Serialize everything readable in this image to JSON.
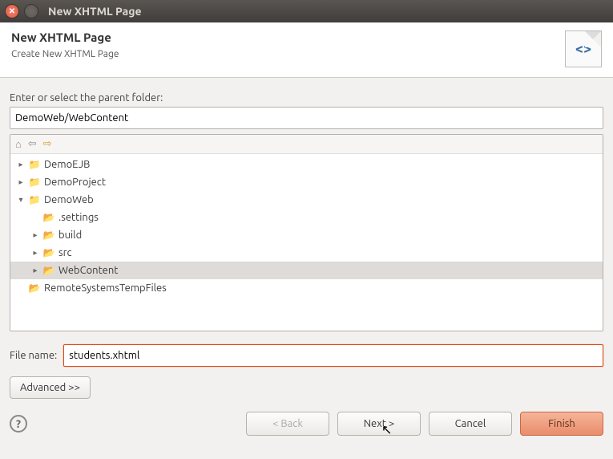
{
  "window": {
    "title": "New XHTML Page"
  },
  "banner": {
    "heading": "New XHTML Page",
    "subtitle": "Create New XHTML Page",
    "icon_glyph": "<>"
  },
  "parentFolder": {
    "label": "Enter or select the parent folder:",
    "value": "DemoWeb/WebContent"
  },
  "toolbar": {
    "home": "⌂",
    "back": "⇦",
    "forward": "⇨"
  },
  "tree": [
    {
      "depth": 0,
      "twisty": "▸",
      "iconType": "proj",
      "iconGlyph": "📁",
      "label": "DemoEJB",
      "selected": false
    },
    {
      "depth": 0,
      "twisty": "▸",
      "iconType": "proj",
      "iconGlyph": "📁",
      "label": "DemoProject",
      "selected": false
    },
    {
      "depth": 0,
      "twisty": "▾",
      "iconType": "proj",
      "iconGlyph": "📁",
      "label": "DemoWeb",
      "selected": false
    },
    {
      "depth": 1,
      "twisty": "",
      "iconType": "folder-open",
      "iconGlyph": "📂",
      "label": ".settings",
      "selected": false
    },
    {
      "depth": 1,
      "twisty": "▸",
      "iconType": "folder-open",
      "iconGlyph": "📂",
      "label": "build",
      "selected": false
    },
    {
      "depth": 1,
      "twisty": "▸",
      "iconType": "folder-open",
      "iconGlyph": "📂",
      "label": "src",
      "selected": false
    },
    {
      "depth": 1,
      "twisty": "▸",
      "iconType": "folder-open",
      "iconGlyph": "📂",
      "label": "WebContent",
      "selected": true
    },
    {
      "depth": 0,
      "twisty": "",
      "iconType": "folder-open",
      "iconGlyph": "📂",
      "label": "RemoteSystemsTempFiles",
      "selected": false
    }
  ],
  "fileName": {
    "label": "File name:",
    "value": "students.xhtml"
  },
  "advanced": {
    "label": "Advanced >>"
  },
  "buttons": {
    "back": "< Back",
    "next": "Next >",
    "cancel": "Cancel",
    "finish": "Finish"
  }
}
